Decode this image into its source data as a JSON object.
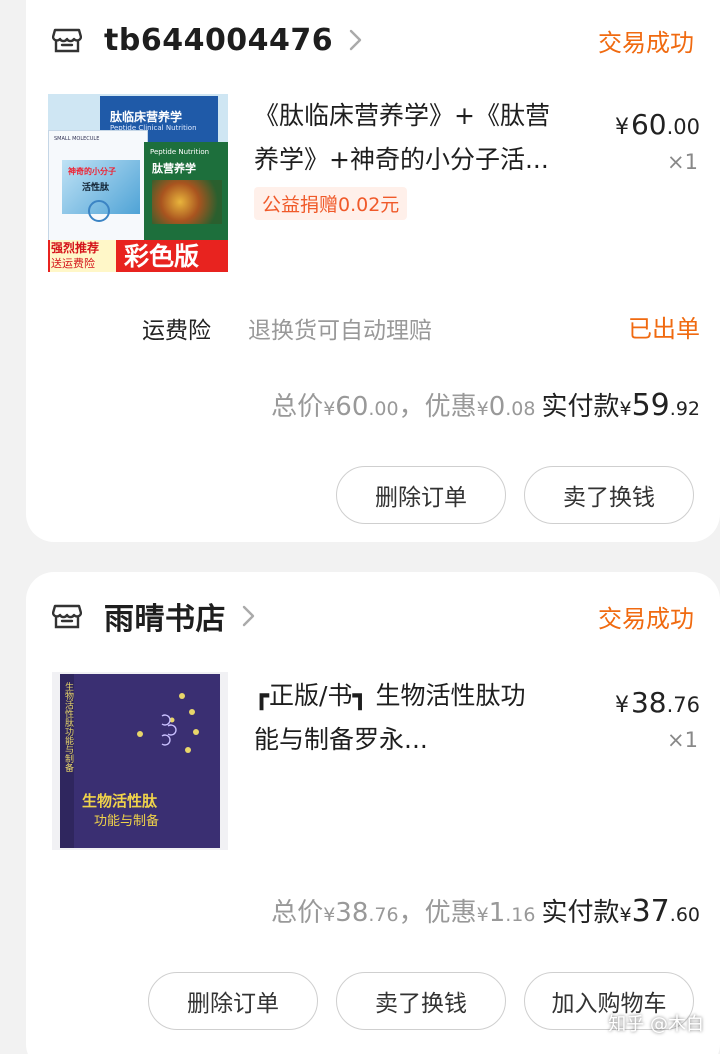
{
  "orders": [
    {
      "shop_name": "tb644004476",
      "status": "交易成功",
      "cover": {
        "title1": "肽临床营养学",
        "subtitle1": "Peptide Clinical Nutrition",
        "title2": "肽营养学",
        "subtitle2": "Peptide Nutrition",
        "title3": "神奇的小分子",
        "title3b": "活性肽",
        "label_small": "SMALL MOLECULE",
        "promo1": "强烈推荐",
        "promo2": "送运费险",
        "color_edition": "彩色版"
      },
      "title_line1": "《肽临床营养学》+《肽营",
      "title_line2": "养学》+神奇的小分子活...",
      "badge": "公益捐赠0.02元",
      "price": {
        "yen": "¥",
        "int": "60",
        "dec": ".00"
      },
      "qty": "×1",
      "insurance": {
        "label": "运费险",
        "desc": "退换货可自动理赔",
        "status": "已出单"
      },
      "totals": {
        "total_label": "总价",
        "total_int": "60",
        "total_dec": ".00",
        "sep": "，",
        "discount_label": "优惠",
        "discount_int": "0",
        "discount_dec": ".08",
        "paid_label": "实付款",
        "paid_int": "59",
        "paid_dec": ".92",
        "yen": "¥"
      },
      "buttons": [
        "删除订单",
        "卖了换钱"
      ]
    },
    {
      "shop_name": "雨晴书店",
      "status": "交易成功",
      "cover": {
        "title": "生物活性肽",
        "title_b": "功能与制备",
        "spine": "生物活性肽功能与制备"
      },
      "title_line1": "┏正版/书┓ 生物活性肽功",
      "title_line2": "能与制备罗永...",
      "price": {
        "yen": "¥",
        "int": "38",
        "dec": ".76"
      },
      "qty": "×1",
      "totals": {
        "total_label": "总价",
        "total_int": "38",
        "total_dec": ".76",
        "sep": "，",
        "discount_label": "优惠",
        "discount_int": "1",
        "discount_dec": ".16",
        "paid_label": "实付款",
        "paid_int": "37",
        "paid_dec": ".60",
        "yen": "¥"
      },
      "buttons": [
        "删除订单",
        "卖了换钱",
        "加入购物车"
      ]
    }
  ],
  "watermark": "知乎 @木白",
  "colors": {
    "accent": "#f06a10",
    "badge_text": "#f05a2a",
    "badge_bg": "#fff0ea",
    "muted": "#999999"
  }
}
